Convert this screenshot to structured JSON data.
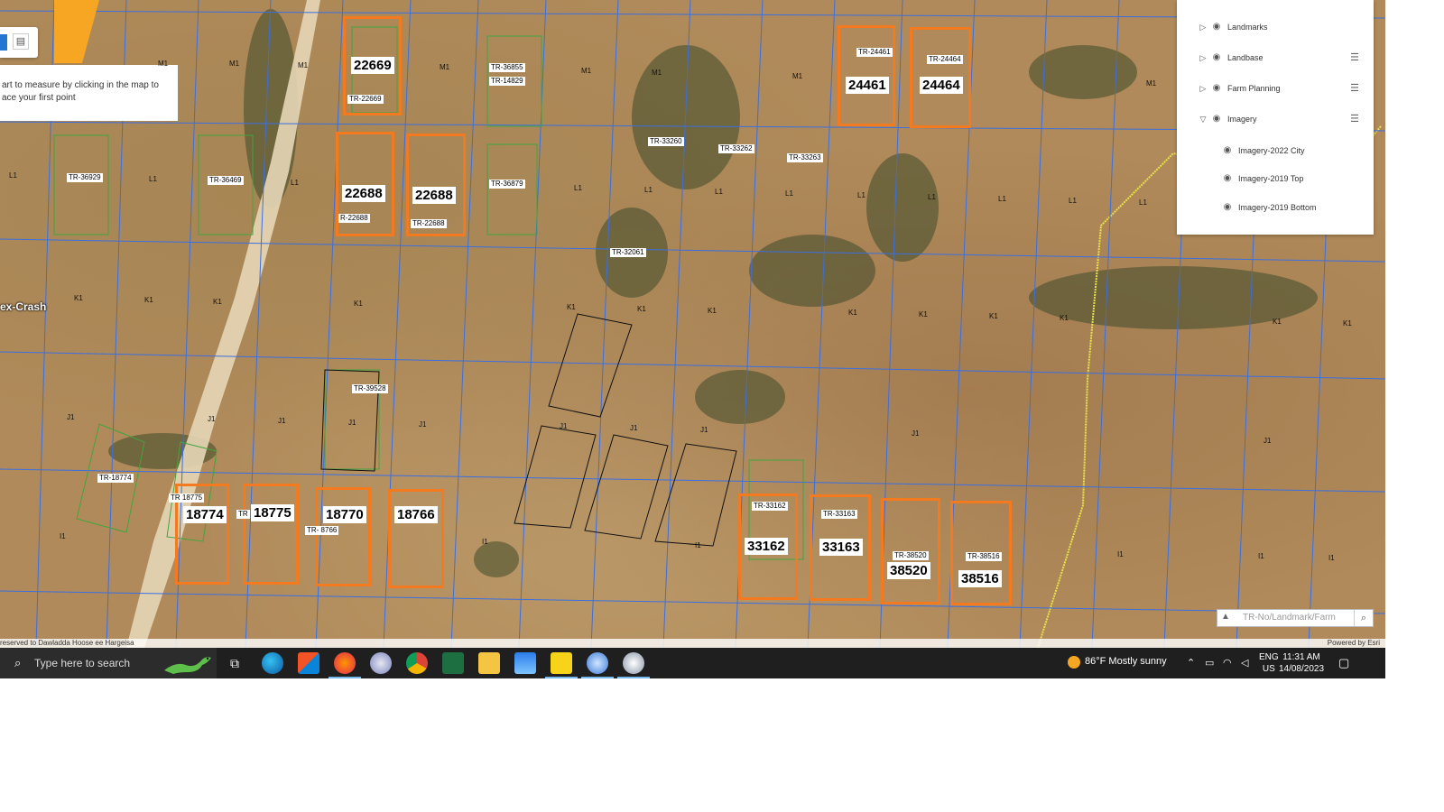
{
  "map": {
    "measure_tip": "art to measure by clicking in the map to ace your first point",
    "place_label": "ex-Crash",
    "attribution_left": "reserved to Dawladda Hoose ee Hargeisa",
    "attribution_right": "Powered by Esri",
    "search_placeholder": "TR-No/Landmark/Farm",
    "parcels": [
      {
        "label": "22669",
        "ref": "TR-22669"
      },
      {
        "label": "24461",
        "ref": "TR-24461"
      },
      {
        "label": "24464",
        "ref": "TR-24464"
      },
      {
        "label": "22688",
        "ref": "R-22688"
      },
      {
        "label": "22688",
        "ref": "TR-22688"
      },
      {
        "label": "18774",
        "ref": "TR 18775"
      },
      {
        "label": "18775",
        "ref": "TR"
      },
      {
        "label": "18770",
        "ref": "TR- 8766"
      },
      {
        "label": "18766",
        "ref": ""
      },
      {
        "label": "33162",
        "ref": "TR-33162"
      },
      {
        "label": "33163",
        "ref": "TR-33163"
      },
      {
        "label": "38520",
        "ref": "TR-38520"
      },
      {
        "label": "38516",
        "ref": "TR-38516"
      }
    ],
    "tr_labels": [
      "TR-36855",
      "TR-14829",
      "TR-36929",
      "TR-36469",
      "TR-36879",
      "TR-33260",
      "TR-33262",
      "TR-33263",
      "TR-32061",
      "TR-39528",
      "TR-18774"
    ],
    "grid_codes": [
      "M1",
      "L1",
      "K1",
      "J1",
      "I1"
    ]
  },
  "layer_panel": {
    "layers": [
      {
        "name": "Landmarks",
        "expanded": false,
        "has_options": false
      },
      {
        "name": "Landbase",
        "expanded": false,
        "has_options": true
      },
      {
        "name": "Farm Planning",
        "expanded": false,
        "has_options": true
      },
      {
        "name": "Imagery",
        "expanded": true,
        "has_options": true
      }
    ],
    "sublayers": [
      "Imagery-2022 City",
      "Imagery-2019 Top",
      "Imagery-2019 Bottom"
    ]
  },
  "taskbar": {
    "search_placeholder": "Type here to search",
    "weather": "86°F  Mostly sunny",
    "lang_top": "ENG",
    "lang_bottom": "US",
    "time": "11:31 AM",
    "date": "14/08/2023",
    "apps": [
      "task-view",
      "edge",
      "store",
      "firefox",
      "paint-app",
      "chrome",
      "excel",
      "file-explorer",
      "app-blue",
      "sticky-notes",
      "app-globe",
      "app-disc"
    ],
    "active_apps": [
      "firefox",
      "sticky-notes"
    ]
  },
  "colors": {
    "parcel_outline": "#f47a20",
    "grid_blue": "#3b6fe0",
    "grid_green": "#3fa63f",
    "road_yellow": "#e8e24a",
    "taskbar": "#1f1f1f"
  }
}
